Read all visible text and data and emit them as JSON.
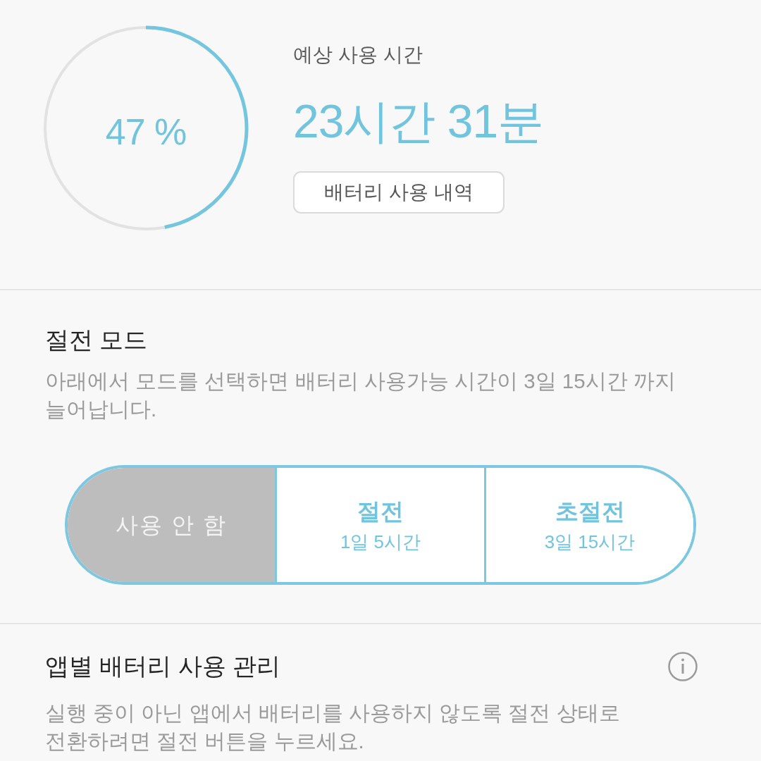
{
  "battery": {
    "level": 0.47,
    "percent": "47 %"
  },
  "estimate": {
    "label": "예상 사용 시간",
    "time": "23시간 31분",
    "history_button": "배터리 사용 내역"
  },
  "power_saving": {
    "title": "절전 모드",
    "description": "아래에서 모드를 선택하면 배터리 사용가능 시간이 3일 15시간 까지 늘어납니다.",
    "modes": [
      {
        "label": "사용 안 함",
        "selected": true
      },
      {
        "label": "절전",
        "duration": "1일 5시간",
        "selected": false
      },
      {
        "label": "초절전",
        "duration": "3일 15시간",
        "selected": false
      }
    ]
  },
  "app_power": {
    "title": "앱별 배터리 사용 관리",
    "description": "실행 중이 아닌 앱에서 배터리를 사용하지 않도록 절전 상태로 전환하려면 절전 버튼을 누르세요."
  }
}
